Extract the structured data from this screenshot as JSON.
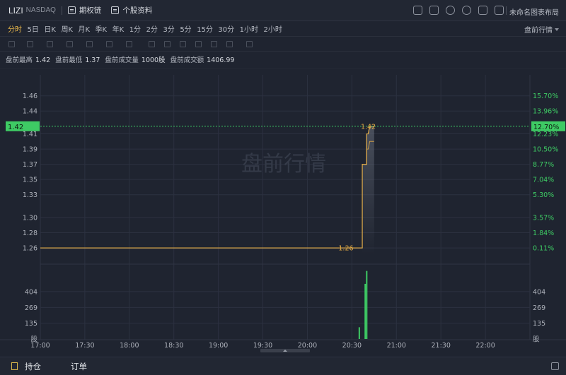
{
  "header": {
    "ticker": "LIZI",
    "exchange": "NASDAQ",
    "options_chain": "期权链",
    "company_profile": "个股资料",
    "layout_name": "未命名图表布局",
    "icons": [
      "display-icon",
      "pencil-icon",
      "refresh-icon",
      "settings-icon",
      "fullscreen-icon",
      "window-icon"
    ]
  },
  "periods": {
    "items": [
      "分时",
      "5日",
      "日K",
      "周K",
      "月K",
      "季K",
      "年K",
      "1分",
      "2分",
      "3分",
      "5分",
      "15分",
      "30分",
      "1小时",
      "2小时"
    ],
    "active": "分时",
    "session": "盘前行情"
  },
  "stats": {
    "high_label": "盘前最高",
    "high": "1.42",
    "low_label": "盘前最低",
    "low": "1.37",
    "volume_label": "盘前成交量",
    "volume": "1000股",
    "turnover_label": "盘前成交额",
    "turnover": "1406.99"
  },
  "chart_data": {
    "type": "line",
    "watermark": "盘前行情",
    "price_ticks": [
      "1.46",
      "1.44",
      "1.41",
      "1.39",
      "1.37",
      "1.35",
      "1.33",
      "1.30",
      "1.28",
      "1.26"
    ],
    "pct_ticks": [
      "15.70%",
      "13.96%",
      "12.23%",
      "10.50%",
      "8.77%",
      "7.04%",
      "5.30%",
      "3.57%",
      "1.84%",
      "0.11%"
    ],
    "price_values": [
      1.46,
      1.44,
      1.41,
      1.39,
      1.37,
      1.35,
      1.33,
      1.3,
      1.28,
      1.26
    ],
    "current_price": "1.42",
    "current_pct": "12.70%",
    "volume_ticks": [
      "404",
      "269",
      "135"
    ],
    "volume_unit": "股",
    "x_ticks": [
      "17:00",
      "17:30",
      "18:00",
      "18:30",
      "19:00",
      "19:30",
      "20:00",
      "20:30",
      "21:00",
      "21:30",
      "22:00"
    ],
    "price_line": {
      "x": [
        "17:00",
        "20:37",
        "20:37",
        "20:40",
        "20:40",
        "20:41",
        "20:42",
        "20:44",
        "20:45"
      ],
      "y": [
        1.26,
        1.26,
        1.37,
        1.37,
        1.41,
        1.41,
        1.42,
        1.42,
        1.42
      ]
    },
    "avg_line": {
      "x": [
        "20:37",
        "20:40",
        "20:40",
        "20:41",
        "20:42",
        "20:45"
      ],
      "y": [
        1.37,
        1.37,
        1.39,
        1.39,
        1.4,
        1.4
      ]
    },
    "annotations": [
      {
        "x": "17:00",
        "y": 1.26,
        "text": "1.26"
      },
      {
        "x": "20:42",
        "y": 1.42,
        "text": "1.42"
      }
    ],
    "volume_bars": [
      {
        "x": "20:35",
        "v": 100
      },
      {
        "x": "20:39",
        "v": 470
      },
      {
        "x": "20:40",
        "v": 580
      }
    ],
    "colors": {
      "line": "#e0a944",
      "current": "#3ecb64",
      "volume": "#3ecb64",
      "grid": "#2c3140"
    }
  },
  "bottom": {
    "positions": "持仓",
    "orders": "订单"
  }
}
